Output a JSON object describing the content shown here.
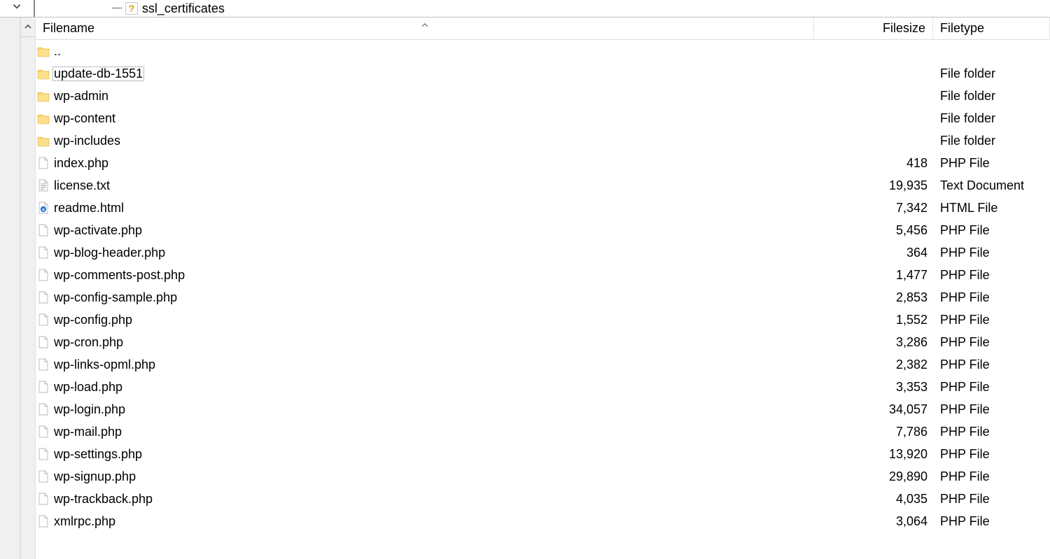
{
  "tree": {
    "visible_item_label": "ssl_certificates"
  },
  "columns": {
    "filename": "Filename",
    "filesize": "Filesize",
    "filetype": "Filetype"
  },
  "parent_row": {
    "name": "..",
    "icon": "folder",
    "size": "",
    "type": ""
  },
  "rows": [
    {
      "name": "update-db-1551",
      "icon": "folder",
      "size": "",
      "type": "File folder",
      "selected": true
    },
    {
      "name": "wp-admin",
      "icon": "folder",
      "size": "",
      "type": "File folder"
    },
    {
      "name": "wp-content",
      "icon": "folder",
      "size": "",
      "type": "File folder"
    },
    {
      "name": "wp-includes",
      "icon": "folder",
      "size": "",
      "type": "File folder"
    },
    {
      "name": "index.php",
      "icon": "file",
      "size": "418",
      "type": "PHP File"
    },
    {
      "name": "license.txt",
      "icon": "txt",
      "size": "19,935",
      "type": "Text Document"
    },
    {
      "name": "readme.html",
      "icon": "html",
      "size": "7,342",
      "type": "HTML File"
    },
    {
      "name": "wp-activate.php",
      "icon": "file",
      "size": "5,456",
      "type": "PHP File"
    },
    {
      "name": "wp-blog-header.php",
      "icon": "file",
      "size": "364",
      "type": "PHP File"
    },
    {
      "name": "wp-comments-post.php",
      "icon": "file",
      "size": "1,477",
      "type": "PHP File"
    },
    {
      "name": "wp-config-sample.php",
      "icon": "file",
      "size": "2,853",
      "type": "PHP File"
    },
    {
      "name": "wp-config.php",
      "icon": "file",
      "size": "1,552",
      "type": "PHP File"
    },
    {
      "name": "wp-cron.php",
      "icon": "file",
      "size": "3,286",
      "type": "PHP File"
    },
    {
      "name": "wp-links-opml.php",
      "icon": "file",
      "size": "2,382",
      "type": "PHP File"
    },
    {
      "name": "wp-load.php",
      "icon": "file",
      "size": "3,353",
      "type": "PHP File"
    },
    {
      "name": "wp-login.php",
      "icon": "file",
      "size": "34,057",
      "type": "PHP File"
    },
    {
      "name": "wp-mail.php",
      "icon": "file",
      "size": "7,786",
      "type": "PHP File"
    },
    {
      "name": "wp-settings.php",
      "icon": "file",
      "size": "13,920",
      "type": "PHP File"
    },
    {
      "name": "wp-signup.php",
      "icon": "file",
      "size": "29,890",
      "type": "PHP File"
    },
    {
      "name": "wp-trackback.php",
      "icon": "file",
      "size": "4,035",
      "type": "PHP File"
    },
    {
      "name": "xmlrpc.php",
      "icon": "file",
      "size": "3,064",
      "type": "PHP File"
    }
  ]
}
